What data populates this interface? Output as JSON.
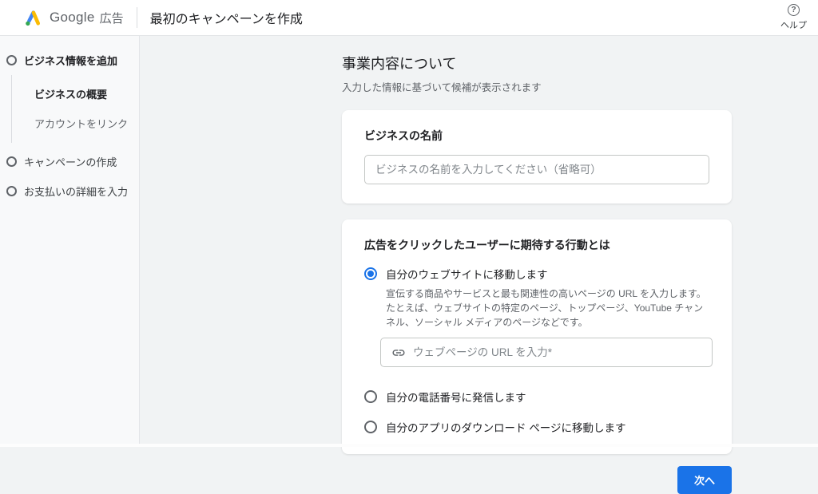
{
  "header": {
    "brand": {
      "google": "Google",
      "product": "広告"
    },
    "title": "最初のキャンペーンを作成",
    "help_label": "ヘルプ",
    "help_icon_glyph": "?"
  },
  "sidebar": {
    "steps": [
      {
        "label": "ビジネス情報を追加",
        "bold": true,
        "substeps": [
          {
            "label": "ビジネスの概要",
            "active": true
          },
          {
            "label": "アカウントをリンク",
            "active": false
          }
        ]
      },
      {
        "label": "キャンペーンの作成",
        "bold": false
      },
      {
        "label": "お支払いの詳細を入力",
        "bold": false
      }
    ]
  },
  "main": {
    "title": "事業内容について",
    "subtitle": "入力した情報に基づいて候補が表示されます",
    "business_name_card": {
      "label": "ビジネスの名前",
      "input_value": "",
      "input_placeholder": "ビジネスの名前を入力してください（省略可）"
    },
    "action_card": {
      "label": "広告をクリックしたユーザーに期待する行動とは",
      "options": [
        {
          "label": "自分のウェブサイトに移動します",
          "selected": true,
          "description": "宣伝する商品やサービスと最も関連性の高いページの URL を入力します。たとえば、ウェブサイトの特定のページ、トップページ、YouTube チャンネル、ソーシャル メディアのページなどです。",
          "url_value": "",
          "url_placeholder": "ウェブページの URL を入力*"
        },
        {
          "label": "自分の電話番号に発信します",
          "selected": false
        },
        {
          "label": "自分のアプリのダウンロード ページに移動します",
          "selected": false
        }
      ]
    },
    "next_button_label": "次へ"
  },
  "colors": {
    "accent_blue": "#1a73e8",
    "logo_blue": "#4285f4",
    "logo_yellow": "#fbbc04",
    "logo_green": "#34a853",
    "text_primary": "#202124",
    "text_secondary": "#5f6368",
    "main_background": "#f1f3f4"
  }
}
